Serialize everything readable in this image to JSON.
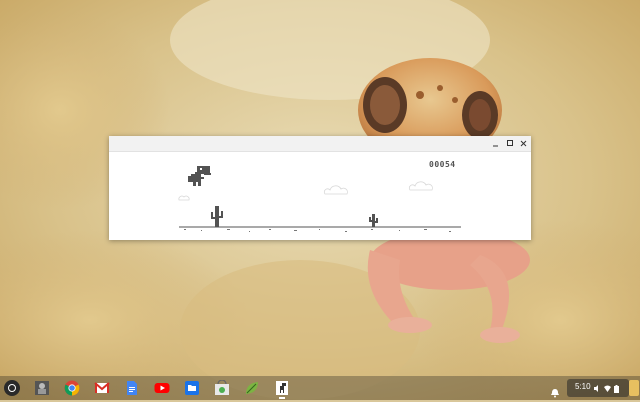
{
  "window": {
    "minimize_label": "_",
    "maximize_label": "□",
    "close_label": "×"
  },
  "game": {
    "score": "00054"
  },
  "shelf": {
    "apps": [
      "photos",
      "chrome",
      "gmail",
      "docs",
      "youtube",
      "files",
      "store",
      "leaf",
      "dino-app"
    ],
    "clock": "5:10"
  }
}
